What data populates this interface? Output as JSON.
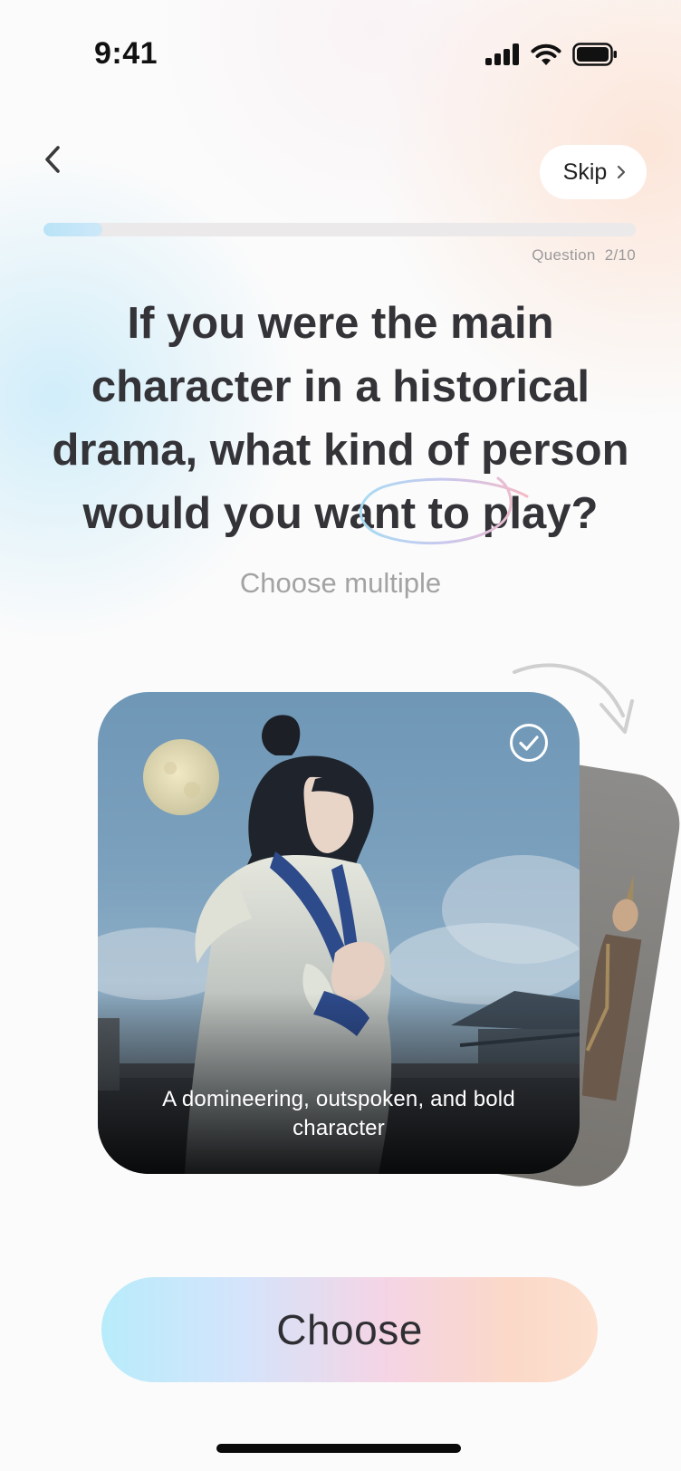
{
  "status_bar": {
    "time": "9:41"
  },
  "header": {
    "back_icon": "chevron-left-icon",
    "skip_label": "Skip",
    "skip_icon": "chevron-right-icon"
  },
  "progress": {
    "current": 2,
    "total": 10,
    "fraction": 0.1,
    "label_prefix": "Question",
    "label_value": "2/10"
  },
  "question": {
    "text": "If you were the main character in a historical drama, what kind of person would you want to play?",
    "hint": "Choose multiple"
  },
  "cards": {
    "front": {
      "caption": "A domineering, outspoken, and bold character",
      "selected": true,
      "check_icon": "check-circle-icon"
    },
    "back": {}
  },
  "actions": {
    "choose_label": "Choose"
  },
  "colors": {
    "progress_fill": "#b9e3f7",
    "progress_track": "#ebe9e9",
    "button_gradient_start": "#b8ecfb",
    "button_gradient_end": "#fde0cf",
    "text_primary": "#333338",
    "text_secondary": "#a3a3a3"
  }
}
